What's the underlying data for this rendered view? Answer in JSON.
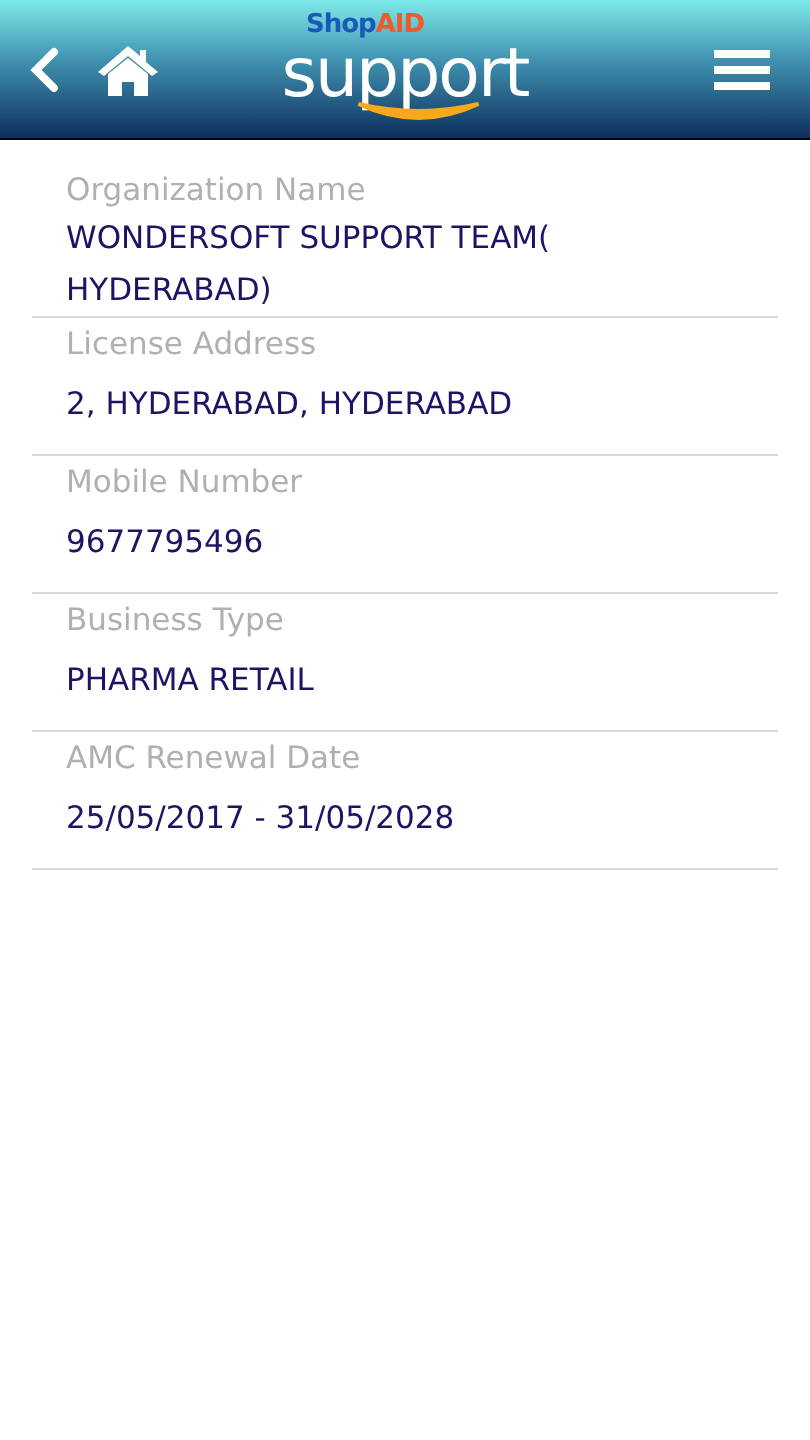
{
  "header": {
    "logo": {
      "brand_parts": [
        "Shop",
        "AID"
      ],
      "wordmark": "support"
    }
  },
  "fields": [
    {
      "label": "Organization Name",
      "value": "WONDERSOFT SUPPORT TEAM( HYDERABAD)"
    },
    {
      "label": "License Address",
      "value": "2, HYDERABAD, HYDERABAD"
    },
    {
      "label": "Mobile Number",
      "value": "9677795496"
    },
    {
      "label": "Business Type",
      "value": "PHARMA RETAIL"
    },
    {
      "label": "AMC Renewal Date",
      "value": "25/05/2017 -  31/05/2028"
    }
  ]
}
